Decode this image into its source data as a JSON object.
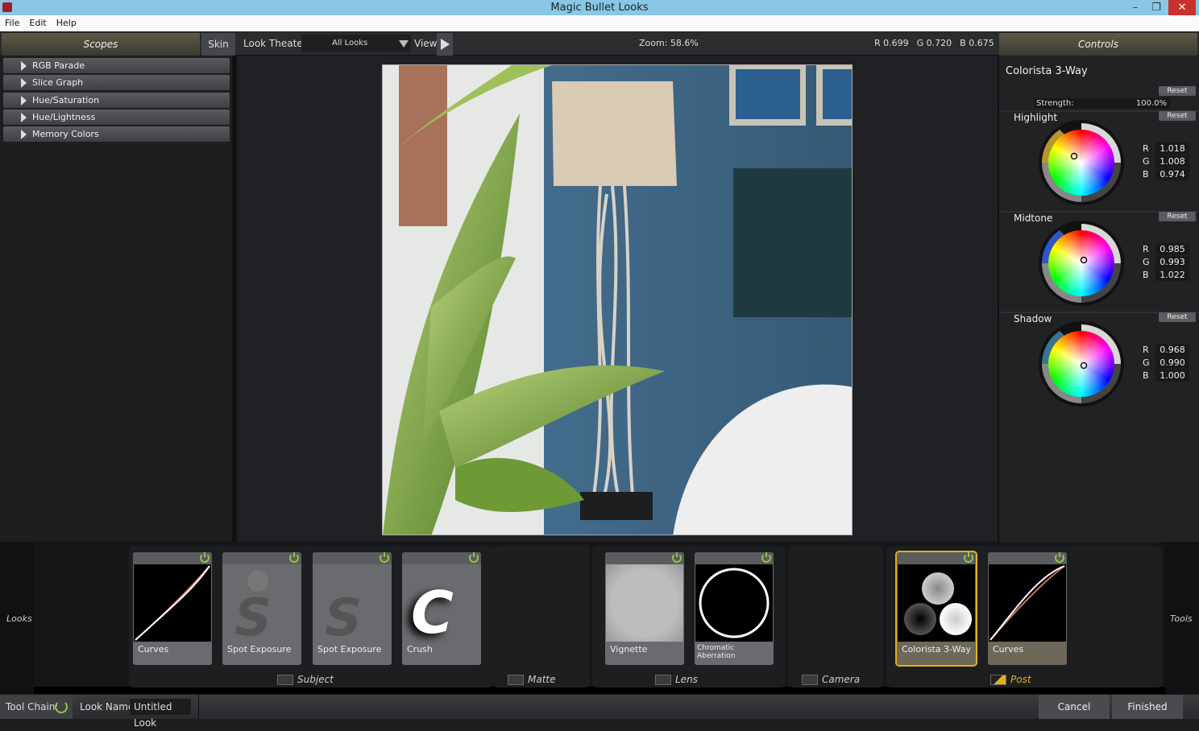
{
  "window": {
    "title": "Magic Bullet Looks",
    "minimize": "–",
    "maximize": "❐",
    "close": "✕"
  },
  "menu": [
    "File",
    "Edit",
    "Help"
  ],
  "toolbar": {
    "scopes": "Scopes",
    "skin": "Skin",
    "look_theater": "Look Theater",
    "looks_filter": "All Looks",
    "view": "View",
    "zoom_label": "Zoom:",
    "zoom_value": "58.6%",
    "readout": {
      "r": "R 0.699",
      "g": "G 0.720",
      "b": "B 0.675"
    },
    "controls": "Controls"
  },
  "scopes": [
    "RGB Parade",
    "Slice Graph",
    "Hue/Saturation",
    "Hue/Lightness",
    "Memory Colors"
  ],
  "controls": {
    "tool_name": "Colorista 3-Way",
    "reset": "Reset",
    "strength_label": "Strength:",
    "strength_value": "100.0%",
    "wheels": [
      {
        "name": "Highlight",
        "r": "1.018",
        "g": "1.008",
        "b": "0.974",
        "ring_color": "#b8962e"
      },
      {
        "name": "Midtone",
        "r": "0.985",
        "g": "0.993",
        "b": "1.022",
        "ring_color": "#2e55c8"
      },
      {
        "name": "Shadow",
        "r": "0.968",
        "g": "0.990",
        "b": "1.000",
        "ring_color": "#3a7390"
      }
    ],
    "rgb_labels": [
      "R",
      "G",
      "B"
    ]
  },
  "looks_panel": {
    "left_label": "Looks",
    "right_label": "Tools",
    "groups": [
      {
        "name": "Subject",
        "tools": [
          "Curves",
          "Spot Exposure",
          "Spot Exposure",
          "Crush"
        ]
      },
      {
        "name": "Matte",
        "tools": []
      },
      {
        "name": "Lens",
        "tools": [
          "Vignette",
          "Chromatic Aberration"
        ]
      },
      {
        "name": "Camera",
        "tools": []
      },
      {
        "name": "Post",
        "tools": [
          "Colorista 3-Way",
          "Curves"
        ],
        "active": true
      }
    ],
    "selected_tool": "Colorista 3-Way",
    "accent": "#e0b020"
  },
  "footer": {
    "tool_chain": "Tool Chain:",
    "look_name_label": "Look Name:",
    "look_name": "Untitled Look",
    "cancel": "Cancel",
    "finished": "Finished"
  }
}
